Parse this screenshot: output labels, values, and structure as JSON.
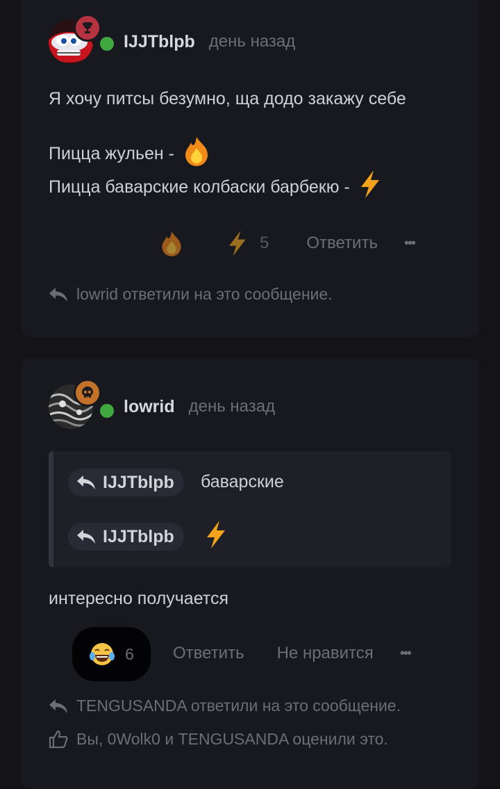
{
  "messages": [
    {
      "username": "IJJTblpb",
      "timestamp": "день назад",
      "avatar_icon": "red-cartoon-car-avatar",
      "badge_icon": "trophy-icon",
      "badge_color": "#b53340",
      "lines": [
        "Я хочу питсы безумно, ща додо закажу себе",
        "Пицца жульен -",
        "Пицца баварские колбаски барбекю -"
      ],
      "reactions": [
        {
          "icon": "fire-emoji",
          "count": ""
        },
        {
          "icon": "lightning-emoji",
          "count": "5"
        }
      ],
      "reply_label": "Ответить",
      "more_label": "•••",
      "replied_note": "lowrid ответили на это сообщение."
    },
    {
      "username": "lowrid",
      "timestamp": "день назад",
      "avatar_icon": "dark-pattern-avatar",
      "badge_icon": "skull-icon",
      "badge_color": "#c4722a",
      "quotes": [
        {
          "author": "IJJTblpb",
          "text": "баварские"
        },
        {
          "author": "IJJTblpb",
          "text": ""
        }
      ],
      "body": "интересно получается",
      "reaction": {
        "icon": "laughing-tears-emoji",
        "count": "6"
      },
      "reply_label": "Ответить",
      "dislike_label": "Не нравится",
      "more_label": "•••",
      "replied_note": "TENGUSANDA ответили на это сообщение.",
      "liked_note": "Вы, 0Wolk0 и TENGUSANDA оценили это."
    }
  ],
  "colors": {
    "background": "#131318",
    "card": "#18181f",
    "online": "#3fa83f",
    "muted": "#6d6d78"
  }
}
